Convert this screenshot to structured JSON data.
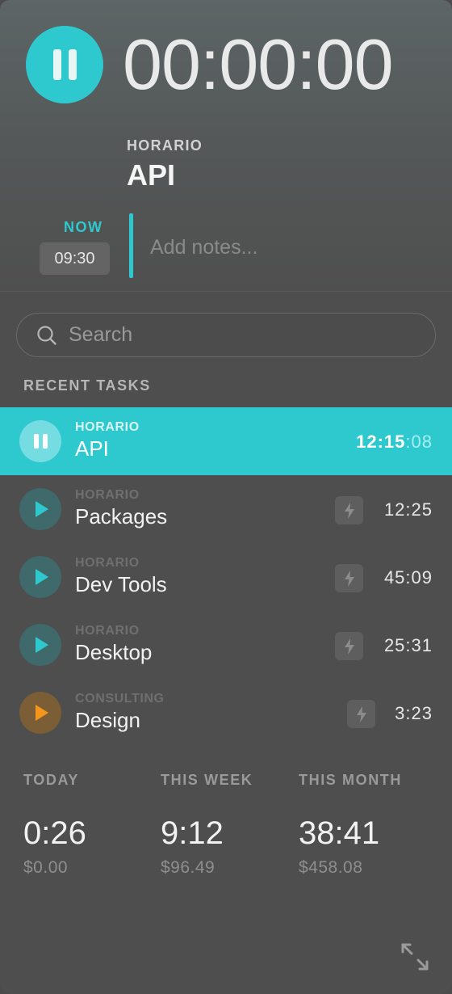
{
  "current": {
    "timer": "00:00:00",
    "project": "HORARIO",
    "task": "API",
    "now_label": "NOW",
    "start_time": "09:30",
    "notes_placeholder": "Add notes..."
  },
  "search": {
    "placeholder": "Search"
  },
  "recent": {
    "title": "RECENT TASKS",
    "tasks": [
      {
        "project": "HORARIO",
        "name": "API",
        "duration_main": "12:15",
        "duration_sec": ":08",
        "state": "running",
        "accent": "#2ec9cf"
      },
      {
        "project": "HORARIO",
        "name": "Packages",
        "duration": "12:25",
        "state": "idle",
        "accent": "#2ec9cf"
      },
      {
        "project": "HORARIO",
        "name": "Dev Tools",
        "duration": "45:09",
        "state": "idle",
        "accent": "#2ec9cf"
      },
      {
        "project": "HORARIO",
        "name": "Desktop",
        "duration": "25:31",
        "state": "idle",
        "accent": "#2ec9cf"
      },
      {
        "project": "CONSULTING",
        "name": "Design",
        "duration": "3:23",
        "state": "idle",
        "accent": "#f5961b"
      }
    ]
  },
  "stats": [
    {
      "label": "TODAY",
      "time": "0:26",
      "amount": "$0.00"
    },
    {
      "label": "THIS WEEK",
      "time": "9:12",
      "amount": "$96.49"
    },
    {
      "label": "THIS MONTH",
      "time": "38:41",
      "amount": "$458.08"
    }
  ],
  "icons": {
    "main_action": "pause-icon",
    "task_action": "play-icon",
    "task_secondary": "bolt-icon",
    "search": "search-icon",
    "window": "expand-icon"
  }
}
